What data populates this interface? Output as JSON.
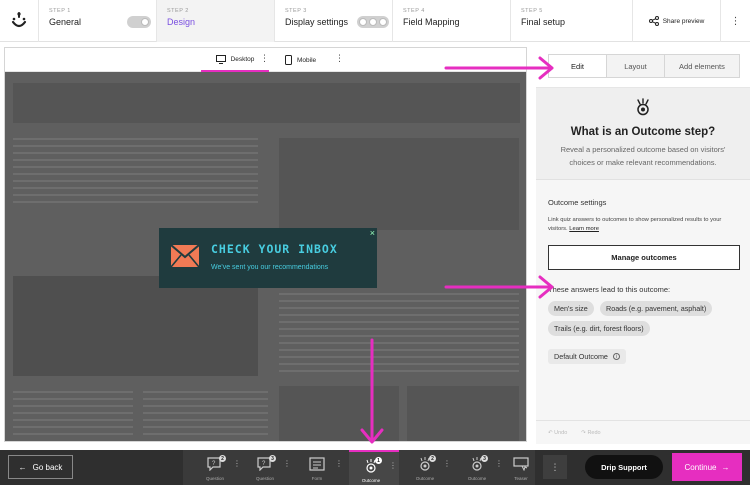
{
  "steps": [
    {
      "num": "STEP 1",
      "title": "General"
    },
    {
      "num": "STEP 2",
      "title": "Design"
    },
    {
      "num": "STEP 3",
      "title": "Display settings"
    },
    {
      "num": "STEP 4",
      "title": "Field Mapping"
    },
    {
      "num": "STEP 5",
      "title": "Final setup"
    }
  ],
  "share_label": "Share preview",
  "devices": {
    "desktop": "Desktop",
    "mobile": "Mobile"
  },
  "popup": {
    "title": "CHECK YOUR INBOX",
    "subtitle": "We've sent you our recommendations",
    "close": "×"
  },
  "panel_tabs": [
    "Edit",
    "Layout",
    "Add elements"
  ],
  "intro": {
    "title": "What is an Outcome step?",
    "description": "Reveal a personalized outcome based on visitors' choices or make relevant recommendations."
  },
  "outcome_settings": {
    "title": "Outcome settings",
    "description": "Link quiz answers to outcomes to show personalized results to your visitors.",
    "learn_more": "Learn more",
    "manage_button": "Manage outcomes"
  },
  "answers": {
    "title": "These answers lead to this outcome:",
    "chips": [
      "Men's size",
      "Roads (e.g. pavement, asphalt)",
      "Trails (e.g. dirt, forest floors)"
    ]
  },
  "default_outcome": "Default Outcome",
  "undo": "Undo",
  "redo": "Redo",
  "bottom": {
    "go_back": "Go back",
    "nodes": [
      {
        "label": "Question",
        "badge": "2"
      },
      {
        "label": "Question",
        "badge": "3"
      },
      {
        "label": "Form",
        "badge": ""
      },
      {
        "label": "Outcome",
        "badge": "1"
      },
      {
        "label": "Outcome",
        "badge": "2"
      },
      {
        "label": "Outcome",
        "badge": "3"
      },
      {
        "label": "Teaser",
        "badge": ""
      }
    ],
    "drip_support": "Drip Support",
    "continue": "Continue"
  },
  "colors": {
    "accent": "#e62ec0",
    "step_active": "#7a4fe0",
    "popup_bg": "#1f3b3e",
    "popup_text": "#48cde0",
    "envelope": "#f07a55"
  }
}
